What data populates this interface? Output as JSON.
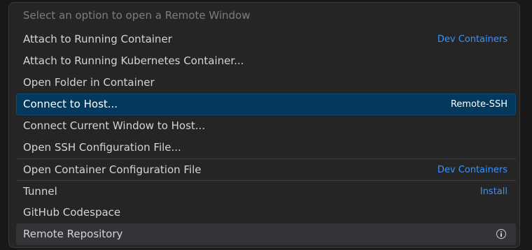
{
  "quick_pick": {
    "placeholder": "Select an option to open a Remote Window",
    "items": [
      {
        "label": "Attach to Running Container",
        "detail": "Dev Containers"
      },
      {
        "label": "Attach to Running Kubernetes Container...",
        "detail": ""
      },
      {
        "label": "Open Folder in Container",
        "detail": ""
      },
      {
        "label": "Connect to Host...",
        "detail": "Remote-SSH"
      },
      {
        "label": "Connect Current Window to Host...",
        "detail": ""
      },
      {
        "label": "Open SSH Configuration File...",
        "detail": ""
      },
      {
        "label": "Open Container Configuration File",
        "detail": "Dev Containers"
      },
      {
        "label": "Tunnel",
        "detail": "Install"
      },
      {
        "label": "GitHub Codespace",
        "detail": ""
      },
      {
        "label": "Remote Repository",
        "detail": "",
        "icon": "info-icon"
      }
    ]
  },
  "colors": {
    "accent_link": "#3794ff",
    "selected_bg": "#04395e",
    "panel_bg": "#252526"
  }
}
